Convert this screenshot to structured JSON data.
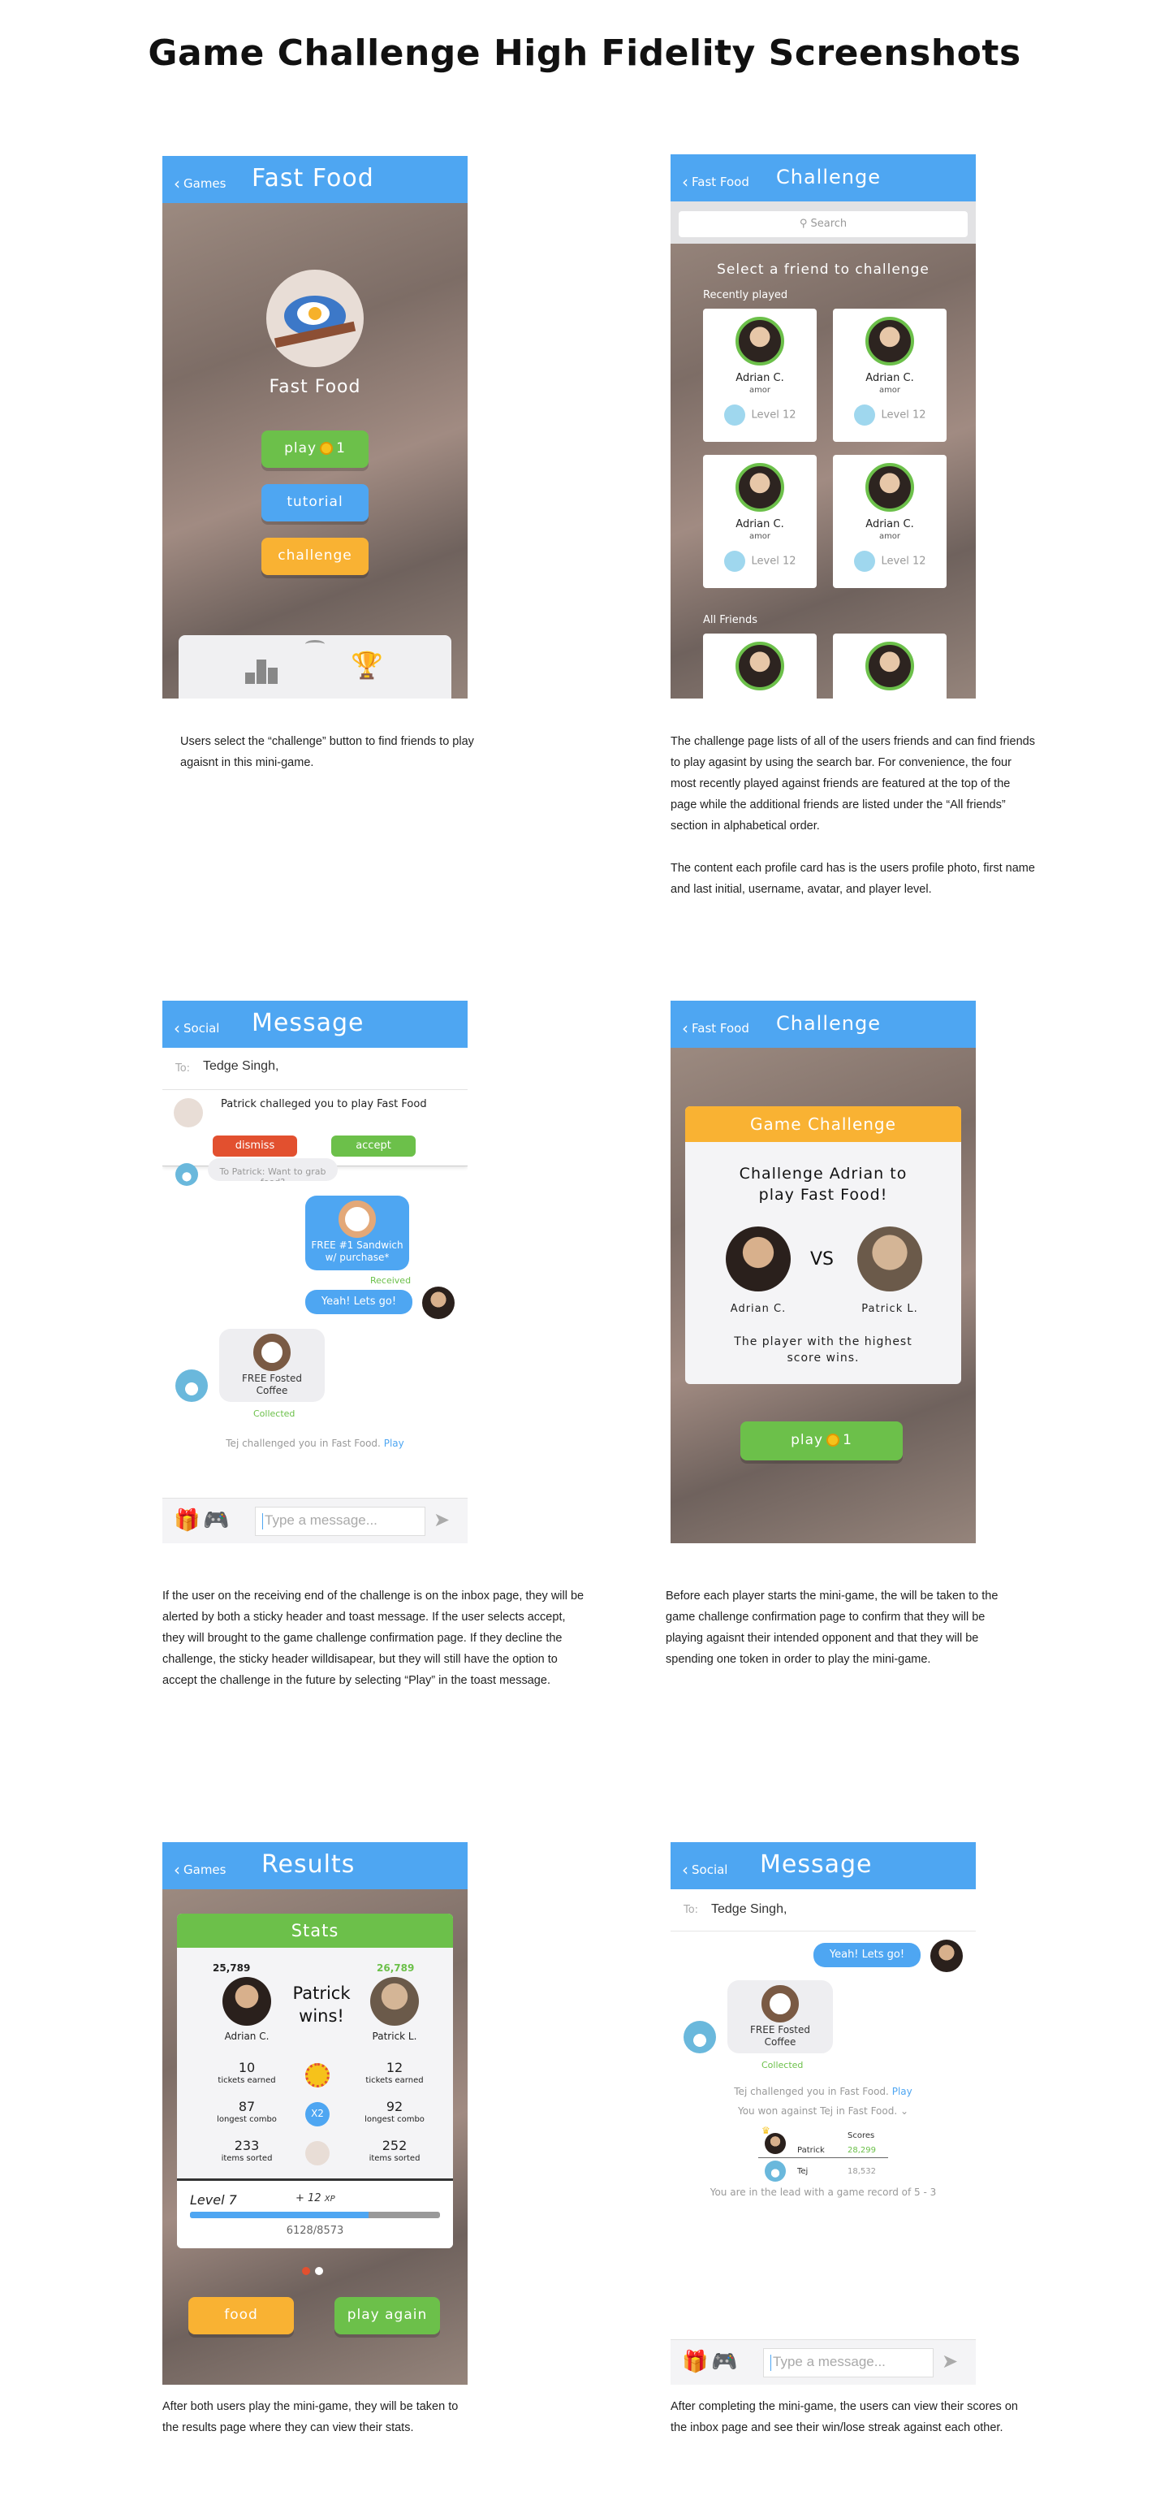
{
  "page": {
    "title": "Game Challenge High Fidelity Screenshots"
  },
  "s1": {
    "back": "Games",
    "title": "Fast Food",
    "game_name": "Fast Food",
    "play": "play",
    "play_cost": "1",
    "tutorial": "tutorial",
    "challenge": "challenge",
    "desc": "Users select the “challenge” button to find friends to play agaisnt in this mini-game."
  },
  "s2": {
    "back": "Fast Food",
    "title": "Challenge",
    "search_placeholder": "Search",
    "heading": "Select a friend to challenge",
    "recent": "Recently played",
    "all": "All Friends",
    "cards": [
      {
        "name": "Adrian C.",
        "user": "amor",
        "level": "Level 12"
      },
      {
        "name": "Adrian C.",
        "user": "amor",
        "level": "Level 12"
      },
      {
        "name": "Adrian C.",
        "user": "amor",
        "level": "Level 12"
      },
      {
        "name": "Adrian C.",
        "user": "amor",
        "level": "Level 12"
      }
    ],
    "desc1": "The challenge page lists of all of the users friends and can find friends to play agasint by using the search bar. For convenience, the four most recently played against friends are featured at the top of the page while the additional friends are listed under the “All friends” section in alphabetical order.",
    "desc2": "The content each profile card has is the users profile photo, first name and last initial, username, avatar, and player level."
  },
  "s3": {
    "back": "Social",
    "title": "Message",
    "to_label": "To:",
    "to_value": "Tedge Singh,",
    "toast_text": "Patrick challeged you to play Fast Food",
    "dismiss": "dismiss",
    "accept": "accept",
    "partial_msg": "To Patrick: Want to grab food?",
    "reward1": "FREE #1 Sandwich w/ purchase*",
    "received": "Received",
    "msg_yeah": "Yeah! Lets go!",
    "reward2": "FREE Fosted Coffee",
    "collected": "Collected",
    "challenged_text": "Tej challenged you in Fast Food.",
    "play_link": "Play",
    "input_placeholder": "Type a message...",
    "desc": "If the user on the receiving end of the challenge is on the inbox page, they will be alerted by both a sticky header and toast message. If the user selects accept, they will brought to  the game challenge confirmation page. If they decline the challenge, the sticky header willdisapear, but they  will still have the option to accept the challenge in the future by selecting “Play” in the toast message."
  },
  "s4": {
    "back": "Fast Food",
    "title": "Challenge",
    "modal_title": "Game Challenge",
    "headline": "Challenge Adrian to play Fast Food!",
    "p1": "Adrian C.",
    "vs": "VS",
    "p2": "Patrick L.",
    "rule": "The player with the highest score wins.",
    "play": "play",
    "play_cost": "1",
    "desc": "Before each player starts the mini-game, the will be taken to  the game challenge confirmation page to confirm that they will be playing agaisnt their intended opponent and that they will be spending one token in order to play the mini-game."
  },
  "s5": {
    "back": "Games",
    "title": "Results",
    "stats_title": "Stats",
    "p1_score": "25,789",
    "p2_score": "26,789",
    "p1_name": "Adrian C.",
    "p2_name": "Patrick L.",
    "winner": "Patrick wins!",
    "rows": [
      {
        "l": "10",
        "ll": "tickets earned",
        "r": "12",
        "rl": "tickets earned"
      },
      {
        "l": "87",
        "ll": "longest combo",
        "r": "92",
        "rl": "longest combo"
      },
      {
        "l": "233",
        "ll": "items sorted",
        "r": "252",
        "rl": "items sorted"
      }
    ],
    "x2": "X2",
    "level": "Level 7",
    "xp_gain": "+ 12",
    "xp_unit": "XP",
    "xp_progress": "6128/8573",
    "xp_fraction": 0.715,
    "food": "food",
    "again": "play again",
    "desc": "After both users play the mini-game, they will be taken to the results page where they can view their stats."
  },
  "s6": {
    "back": "Social",
    "title": "Message",
    "to_label": "To:",
    "to_value": "Tedge Singh,",
    "msg_yeah": "Yeah! Lets go!",
    "reward": "FREE Fosted Coffee",
    "collected": "Collected",
    "challenged_text": "Tej challenged you in Fast Food.",
    "play_link": "Play",
    "won_text": "You won against Tej in Fast Food.",
    "scores_label": "Scores",
    "r1_name": "Patrick",
    "r1_score": "28,299",
    "r2_name": "Tej",
    "r2_score": "18,532",
    "record": "You are in the lead with a game record of 5 - 3",
    "input_placeholder": "Type a message...",
    "desc": "After completing the mini-game, the users can view their scores on the inbox page and see their win/lose streak against each other."
  }
}
